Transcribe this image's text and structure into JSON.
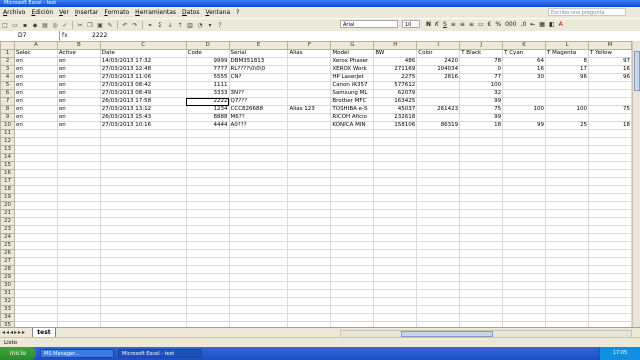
{
  "window": {
    "title": "Microsoft Excel - test"
  },
  "menu": [
    "Archivo",
    "Edición",
    "Ver",
    "Insertar",
    "Formato",
    "Herramientas",
    "Datos",
    "Ventana",
    "?"
  ],
  "help_placeholder": "Escriba una pregunta",
  "font": {
    "name": "Arial",
    "size": "10"
  },
  "formula_bar": {
    "cell_ref": "D7",
    "fx": "fx",
    "value": "2222"
  },
  "columns": [
    "A",
    "B",
    "C",
    "D",
    "E",
    "F",
    "G",
    "H",
    "I",
    "J",
    "K",
    "L",
    "M"
  ],
  "selected_column": "D",
  "header_row": [
    "Selec",
    "Active",
    "Date",
    "Code",
    "Serial",
    "Alias",
    "Model",
    "BW",
    "Color",
    "T Black",
    "T Cyan",
    "T Magenta",
    "T Yellow"
  ],
  "rows": [
    [
      "on",
      "on",
      "14/03/2013 17:32",
      "9999",
      "DBM351813",
      "",
      "Xerox Phaser",
      "486",
      "2420",
      "78",
      "64",
      "8",
      "97"
    ],
    [
      "on",
      "on",
      "27/03/2013 12:48",
      "7777",
      "RL????\\0\\0\\0",
      "",
      "XEROX Work",
      "271169",
      "104034",
      "0",
      "16",
      "17",
      "16"
    ],
    [
      "on",
      "on",
      "27/03/2013 11:06",
      "5555",
      "CN?",
      "",
      "HP LaserJet",
      "2275",
      "2816",
      "77",
      "30",
      "96",
      "96"
    ],
    [
      "on",
      "on",
      "27/03/2013 08:42",
      "1111",
      "",
      "",
      "Canon iR357",
      "577612",
      "",
      "100",
      "",
      "",
      ""
    ],
    [
      "on",
      "on",
      "27/03/2013 08:49",
      "3333",
      "3N??",
      "",
      "Samsung ML",
      "62079",
      "",
      "32",
      "",
      "",
      ""
    ],
    [
      "on",
      "on",
      "26/03/2013 17:58",
      "2222",
      "Q7???",
      "",
      "Brother MFC",
      "163425",
      "",
      "99",
      "",
      "",
      ""
    ],
    [
      "on",
      "on",
      "27/03/2013 13:12",
      "1234",
      "CCC826688",
      "Alias 123",
      "TOSHIBA e-S",
      "45037",
      "261423",
      "75",
      "100",
      "100",
      "75"
    ],
    [
      "on",
      "on",
      "26/03/2013 15:43",
      "8888",
      "M6??",
      "",
      "RICOH Aficio",
      "232618",
      "",
      "99",
      "",
      "",
      ""
    ],
    [
      "on",
      "on",
      "27/03/2013 10:16",
      "4444",
      "A0???",
      "",
      "KONICA MIN",
      "158106",
      "86319",
      "18",
      "99",
      "25",
      "18"
    ]
  ],
  "sheet_tab": "test",
  "status": "Listo",
  "taskbar": {
    "start": "Inicio",
    "buttons": [
      "MS Manager...",
      "Microsoft Excel - test"
    ],
    "clock": "17:05"
  }
}
